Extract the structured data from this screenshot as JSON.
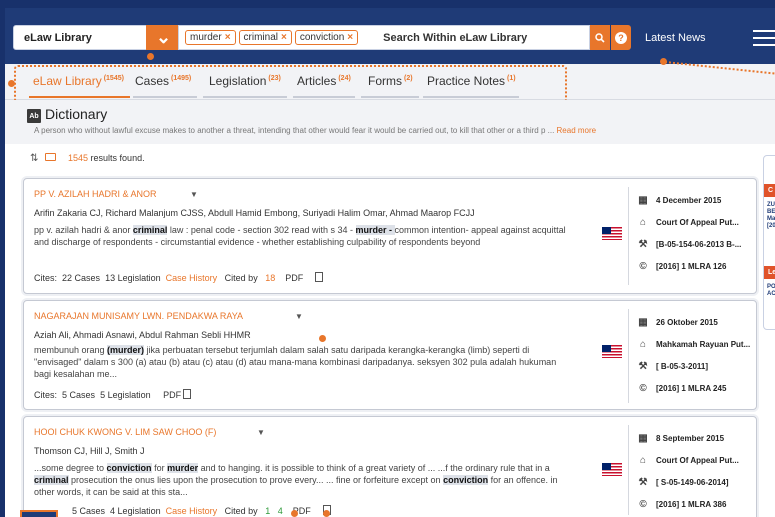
{
  "topbar": {
    "library": "eLaw Library",
    "chips": [
      "murder",
      "criminal",
      "conviction"
    ],
    "search_placeholder": "Search Within eLaw Library",
    "help": "?",
    "latest_news": "Latest News"
  },
  "tabs": [
    {
      "label": "eLaw Library",
      "count": "(1545)",
      "active": true
    },
    {
      "label": "Cases",
      "count": "(1495)"
    },
    {
      "label": "Legislation",
      "count": "(23)"
    },
    {
      "label": "Articles",
      "count": "(24)"
    },
    {
      "label": "Forms",
      "count": "(2)"
    },
    {
      "label": "Practice Notes",
      "count": "(1)"
    }
  ],
  "dictionary": {
    "icon": "Ab",
    "title": "Dictionary",
    "text": "A person who without lawful excuse makes to another a threat, intending that other would fear it would be carried out, to kill that other or a third p ...",
    "read_more": "Read more"
  },
  "results": {
    "count": "1545",
    "suffix": "results found."
  },
  "cards": [
    {
      "title": "PP V. AZILAH HADRI & ANOR",
      "judges": "Arifin Zakaria CJ, Richard Malanjum CJSS, Abdull Hamid Embong, Suriyadi Halim Omar, Ahmad Maarop FCJJ",
      "snippet_1a": "pp v. azilah hadri & anor ",
      "snippet_1b": "criminal",
      "snippet_1c": " law : penal code - section 302 read with s 34 - ",
      "snippet_1d": "murder - ",
      "snippet_1e": "common intention- appeal against acquittal",
      "snippet_2": "and discharge of respondents - circumstantial evidence - whether establishing culpability of respondents beyond",
      "cites": "Cites:",
      "cases": "22 Cases",
      "legislation": "13 Legislation",
      "history": "Case History",
      "cited_by": "Cited by",
      "cited_count": "18",
      "pdf": "PDF",
      "date": "4 December 2015",
      "court": "Court Of Appeal Put...",
      "case_no": "[B-05-154-06-2013 B-...",
      "citation": "[2016] 1 MLRA 126"
    },
    {
      "title": "NAGARAJAN MUNISAMY LWN. PENDAKWA RAYA",
      "judges": "Aziah Ali, Ahmadi Asnawi, Abdul Rahman Sebli HHMR",
      "snippet_1a": "membunuh orang ",
      "snippet_1b": "(murder)",
      "snippet_1c": " jika perbuatan tersebut terjumlah dalam salah satu daripada kerangka-kerangka (limb) seperti di",
      "snippet_2": "\"envisaged\" dalam s 300 (a) atau (b) atau (c) atau (d) atau mana-mana kombinasi daripadanya. seksyen 302 pula adalah hukuman",
      "snippet_3": "bagi kesalahan me...",
      "cites": "Cites:",
      "cases": "5 Cases",
      "legislation": "5 Legislation",
      "pdf": "PDF",
      "date": "26 Oktober 2015",
      "court": "Mahkamah Rayuan Put...",
      "case_no": "[ B-05-3-2011]",
      "citation": "[2016] 1 MLRA 245"
    },
    {
      "title": "HOOI CHUK KWONG V. LIM SAW CHOO (F)",
      "judges": "Thomson CJ, Hill J, Smith J",
      "snippet_1a": "...some degree to ",
      "snippet_1b": "conviction",
      "snippet_1c": " for ",
      "snippet_1d": "murder",
      "snippet_1e": " and to hanging. it is possible to think of a great variety of ... ...f the ordinary rule that in a",
      "snippet_2a": "criminal",
      "snippet_2b": " prosecution the onus lies upon the prosecution to prove every... ... fine or forfeiture except on ",
      "snippet_2c": "conviction",
      "snippet_2d": " for an offence. in",
      "snippet_3": "other words, it can be said at this sta...",
      "cases": "5 Cases",
      "legislation": "4 Legislation",
      "history": "Case History",
      "cited_by": "Cited by",
      "n1": "1",
      "n2": "4",
      "pdf": "PDF",
      "date": "8 September 2015",
      "court": "Court Of Appeal Put...",
      "case_no": "[ S-05-149-06-2014]",
      "citation": "[2016] 1 MLRA 386"
    }
  ],
  "side": {
    "label1": "C",
    "text1": "ZU BE Ma [20",
    "label2": "Le",
    "text2": "PO AC"
  },
  "colors": {
    "accent": "#e8762b",
    "navy": "#1f3b77"
  }
}
